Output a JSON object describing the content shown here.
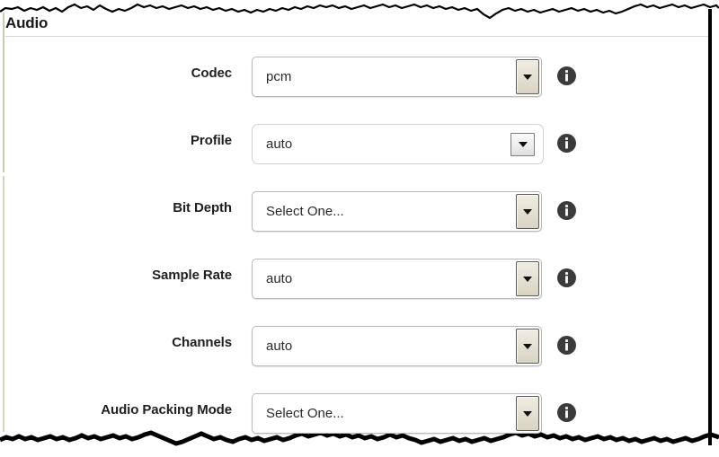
{
  "panel": {
    "title": "Audio"
  },
  "icons": {
    "info": "info-icon",
    "dropdown_arrow": "chevron-down-icon"
  },
  "colors": {
    "heading_text": "#1a1a1a",
    "label_text": "#1f1f1f",
    "value_text": "#2a2a2a",
    "info_icon_fill": "#3b3b3b",
    "frame_right_border": "#000000",
    "separator": "#d6d6d6"
  },
  "form": {
    "rows": [
      {
        "label": "Codec",
        "value": "pcm",
        "control": "dropdown",
        "style": "tall-button",
        "info": "info-icon"
      },
      {
        "label": "Profile",
        "value": "auto",
        "control": "dropdown",
        "style": "small-button",
        "info": "info-icon"
      },
      {
        "label": "Bit Depth",
        "value": "Select One...",
        "control": "dropdown",
        "style": "tall-button",
        "info": "info-icon"
      },
      {
        "label": "Sample Rate",
        "value": "auto",
        "control": "dropdown",
        "style": "tall-button",
        "info": "info-icon"
      },
      {
        "label": "Channels",
        "value": "auto",
        "control": "dropdown",
        "style": "tall-button",
        "info": "info-icon"
      },
      {
        "label": "Audio Packing Mode",
        "value": "Select One...",
        "control": "dropdown",
        "style": "tall-button",
        "info": "info-icon"
      }
    ]
  }
}
